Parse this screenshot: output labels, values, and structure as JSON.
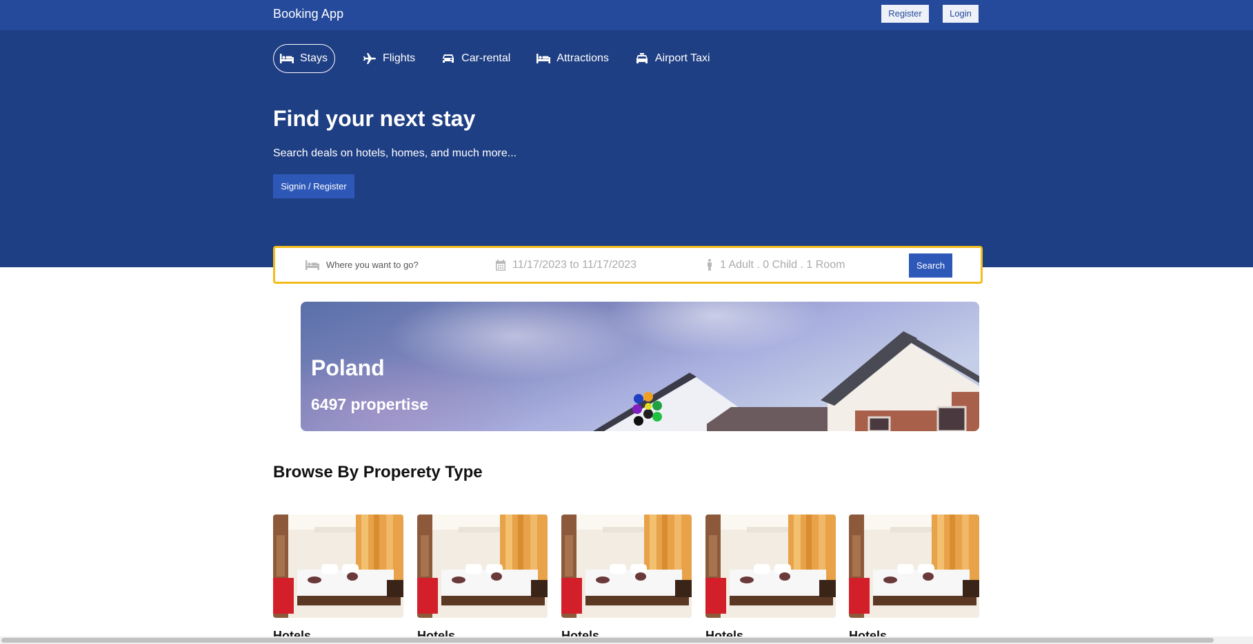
{
  "header": {
    "brand": "Booking App",
    "register_label": "Register",
    "login_label": "Login"
  },
  "tabs": [
    {
      "label": "Stays",
      "icon": "bed-icon",
      "active": true
    },
    {
      "label": "Flights",
      "icon": "plane-icon",
      "active": false
    },
    {
      "label": "Car-rental",
      "icon": "car-icon",
      "active": false
    },
    {
      "label": "Attractions",
      "icon": "bed-icon",
      "active": false
    },
    {
      "label": "Airport Taxi",
      "icon": "taxi-icon",
      "active": false
    }
  ],
  "hero": {
    "title": "Find your next stay",
    "subtitle": "Search deals on hotels, homes, and much more...",
    "signin_label": "Signin / Register"
  },
  "search": {
    "destination_placeholder": "Where you want to go?",
    "dates": "11/17/2023 to 11/17/2023",
    "guests": "1 Adult . 0 Child . 1 Room",
    "button_label": "Search"
  },
  "featured": {
    "title": "Poland",
    "properties": "6497 propertise"
  },
  "browse": {
    "title": "Browse By Properety Type",
    "items": [
      {
        "label": "Hotels"
      },
      {
        "label": "Hotels"
      },
      {
        "label": "Hotels"
      },
      {
        "label": "Hotels"
      },
      {
        "label": "Hotels"
      }
    ]
  },
  "colors": {
    "topbar": "#254a9b",
    "hero": "#1f3f84",
    "accent": "#2e58b8",
    "search_border": "#f3bd1b"
  }
}
